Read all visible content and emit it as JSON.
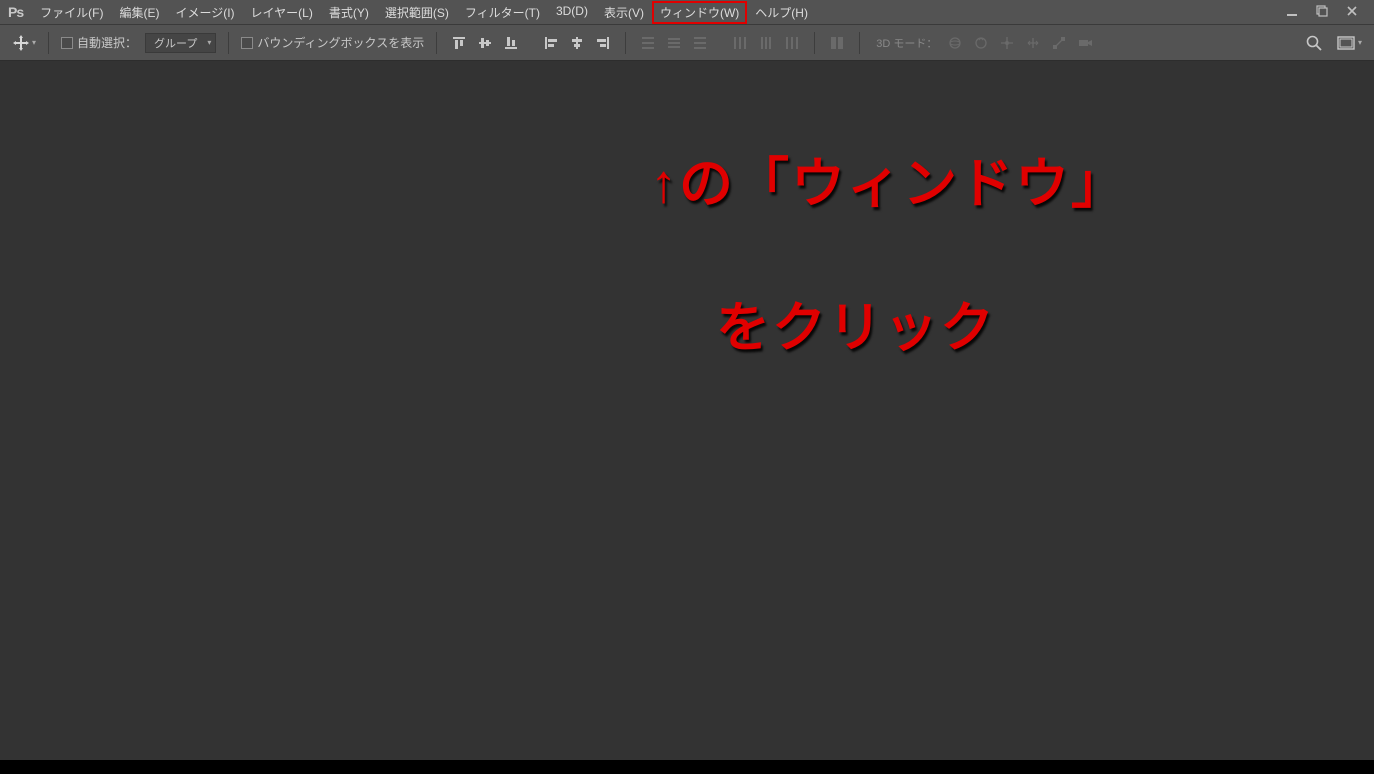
{
  "app": {
    "logo": "Ps"
  },
  "menu": {
    "items": [
      "ファイル(F)",
      "編集(E)",
      "イメージ(I)",
      "レイヤー(L)",
      "書式(Y)",
      "選択範囲(S)",
      "フィルター(T)",
      "3D(D)",
      "表示(V)",
      "ウィンドウ(W)",
      "ヘルプ(H)"
    ],
    "highlighted_index": 9
  },
  "options": {
    "auto_select_label": "自動選択：",
    "select_value": "グループ",
    "bbox_label": "バウンディングボックスを表示",
    "mode_label": "3D モード："
  },
  "annotation": {
    "line1": "↑の「ウィンドウ」",
    "line2": "をクリック"
  }
}
